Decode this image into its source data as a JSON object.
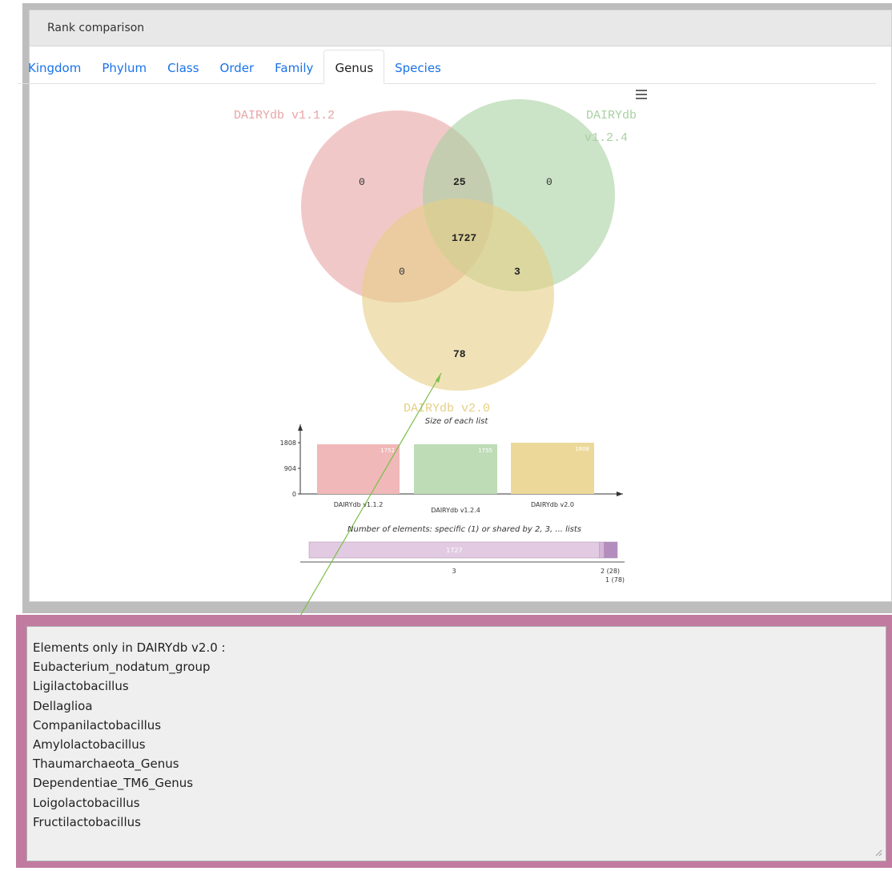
{
  "panel": {
    "title": "Rank comparison"
  },
  "tabs": [
    {
      "label": "Kingdom"
    },
    {
      "label": "Phylum"
    },
    {
      "label": "Class"
    },
    {
      "label": "Order"
    },
    {
      "label": "Family"
    },
    {
      "label": "Genus",
      "active": true
    },
    {
      "label": "Species"
    }
  ],
  "venn": {
    "set_a": {
      "label": "DAIRYdb v1.1.2",
      "color": "#e8a4a4"
    },
    "set_b": {
      "label_line1": "DAIRYdb",
      "label_line2": "v1.2.4",
      "color": "#a8d0a0"
    },
    "set_c": {
      "label": "DAIRYdb v2.0",
      "color": "#e6cf86"
    },
    "regions": {
      "a_only": "0",
      "ab": "25",
      "b_only": "0",
      "abc": "1727",
      "ac": "0",
      "bc": "3",
      "c_only": "78"
    }
  },
  "chart_data": [
    {
      "type": "bar",
      "title": "Size of each list",
      "categories": [
        "DAIRYdb v1.1.2",
        "DAIRYdb v1.2.4",
        "DAIRYdb v2.0"
      ],
      "values": [
        1752,
        1755,
        1808
      ],
      "ylim": [
        0,
        1808
      ],
      "yticks": [
        "0",
        "904",
        "1808"
      ],
      "colors": [
        "#f0b8b8",
        "#bedcb6",
        "#ecd99a"
      ]
    },
    {
      "type": "bar",
      "title": "Number of elements: specific (1) or shared by 2, 3, ... lists",
      "stacked_horizontal": true,
      "segments": [
        {
          "label": "3",
          "value": 1727,
          "inner_label": "1727"
        },
        {
          "label": "2 (28)",
          "value": 28
        },
        {
          "label": "1 (78)",
          "value": 78
        }
      ],
      "colors": [
        "#e2cbe2",
        "#d4b6d6",
        "#b48dbf"
      ]
    }
  ],
  "elements_list": {
    "header": "Elements only in DAIRYdb v2.0 :",
    "items": [
      "Eubacterium_nodatum_group",
      "Ligilactobacillus",
      "Dellaglioa",
      "Companilactobacillus",
      "Amylolactobacillus",
      "Thaumarchaeota_Genus",
      "Dependentiae_TM6_Genus",
      "Loigolactobacillus",
      "Fructilactobacillus"
    ]
  }
}
